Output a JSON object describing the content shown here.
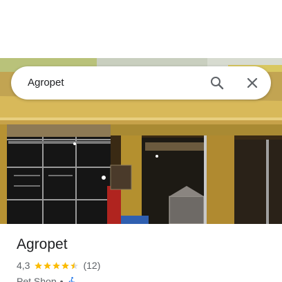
{
  "search": {
    "query": "Agropet",
    "search_icon": "search-icon",
    "close_icon": "close-icon"
  },
  "photo": {
    "subject": "shop-front-photo"
  },
  "place": {
    "name": "Agropet",
    "rating": "4,3",
    "stars_value": 4.3,
    "stars_max": 5,
    "review_count": "(12)",
    "category": "Pet Shop",
    "separator": "•",
    "accessibility_icon": "wheelchair-accessible-icon"
  },
  "colors": {
    "star": "#fbbc04",
    "star_empty": "#dadce0",
    "accessible": "#1a73e8",
    "text_primary": "#202124",
    "text_secondary": "#5f6368"
  }
}
